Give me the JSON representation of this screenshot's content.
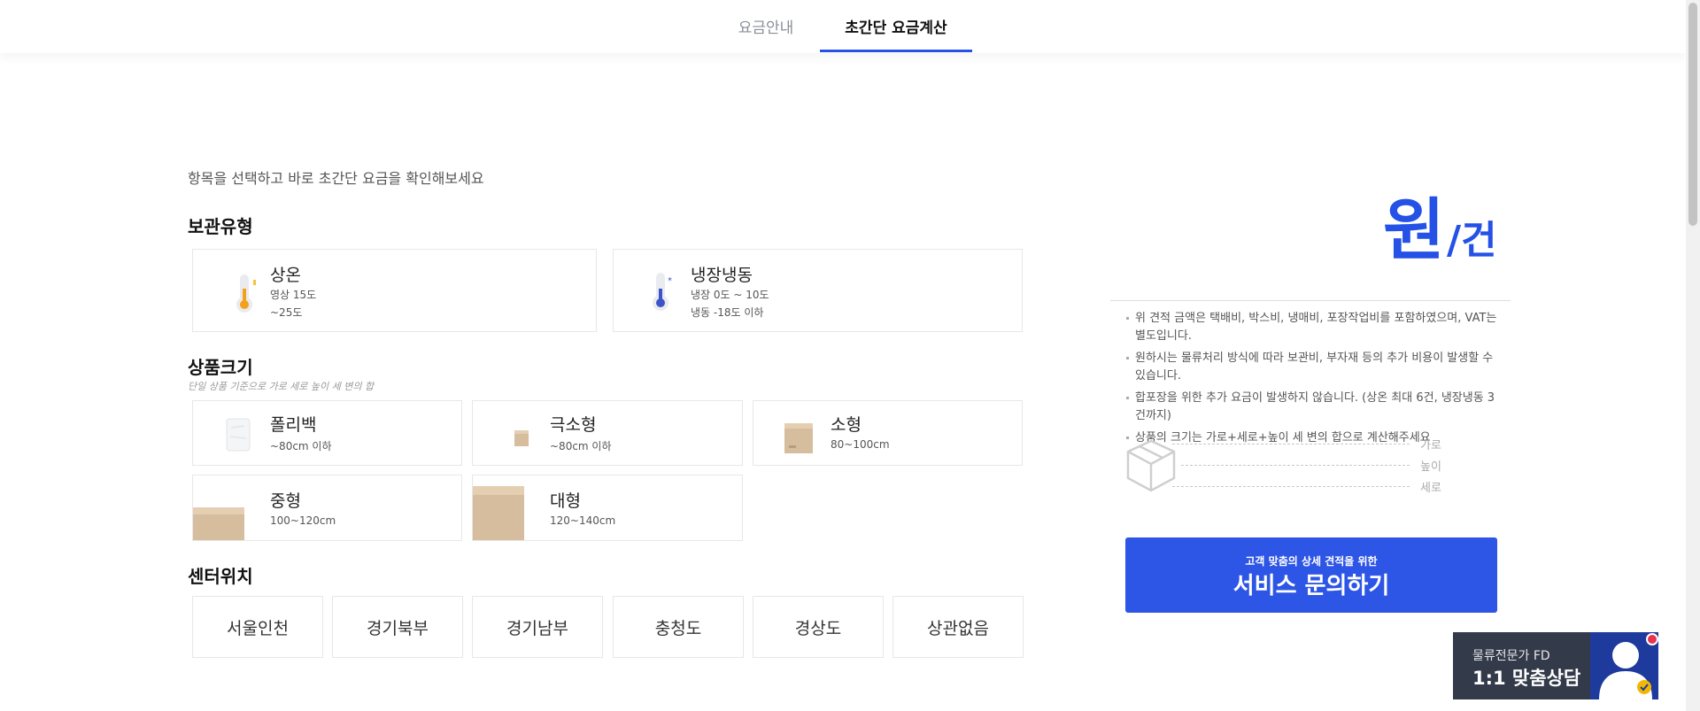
{
  "tabs": [
    {
      "label": "요금안내",
      "active": false
    },
    {
      "label": "초간단 요금계산",
      "active": true
    }
  ],
  "intro": "항목을 선택하고 바로 초간단 요금을 확인해보세요",
  "storage": {
    "title": "보관유형",
    "options": [
      {
        "name": "상온",
        "line1": "영상 15도",
        "line2": "~25도",
        "icon": "thermometer-warm-icon"
      },
      {
        "name": "냉장냉동",
        "line1": "냉장 0도 ~ 10도",
        "line2": "냉동 -18도 이하",
        "icon": "thermometer-cold-icon"
      }
    ]
  },
  "size": {
    "title": "상품크기",
    "note": "단일 상품 기준으로 가로 세로 높이 세 변의 합",
    "options": [
      {
        "name": "폴리백",
        "desc": "~80cm 이하",
        "icon": "poly-bag-icon"
      },
      {
        "name": "극소형",
        "desc": "~80cm 이하",
        "icon": "mini-box-icon"
      },
      {
        "name": "소형",
        "desc": "80~100cm",
        "icon": "small-box-icon"
      },
      {
        "name": "중형",
        "desc": "100~120cm",
        "icon": "medium-box-icon"
      },
      {
        "name": "대형",
        "desc": "120~140cm",
        "icon": "large-box-icon"
      }
    ]
  },
  "location": {
    "title": "센터위치",
    "options": [
      "서울인천",
      "경기북부",
      "경기남부",
      "충청도",
      "경상도",
      "상관없음"
    ]
  },
  "result": {
    "unit_main": "원",
    "unit_sub": "/건",
    "notes": [
      "위 견적 금액은 택배비, 박스비, 냉매비, 포장작업비를 포함하였으며, VAT는 별도입니다.",
      "원하시는 물류처리 방식에 따라 보관비, 부자재 등의 추가 비용이 발생할 수 있습니다.",
      "합포장을 위한 추가 요금이 발생하지 않습니다. (상온 최대 6건, 냉장냉동 3건까지)",
      "상품의 크기는 가로+세로+높이 세 변의 합으로 계산해주세요"
    ],
    "dimensions": [
      "가로",
      "높이",
      "세로"
    ]
  },
  "cta": {
    "small": "고객 맞춤의 상세 견적을 위한",
    "big": "서비스 문의하기"
  },
  "consult": {
    "line1": "물류전문가 FD",
    "line2": "1:1 맞춤상담"
  },
  "colors": {
    "accent": "#2451e6",
    "button": "#2d55e6",
    "consult_bg": "#333a49",
    "box": "#d6bd9e"
  }
}
